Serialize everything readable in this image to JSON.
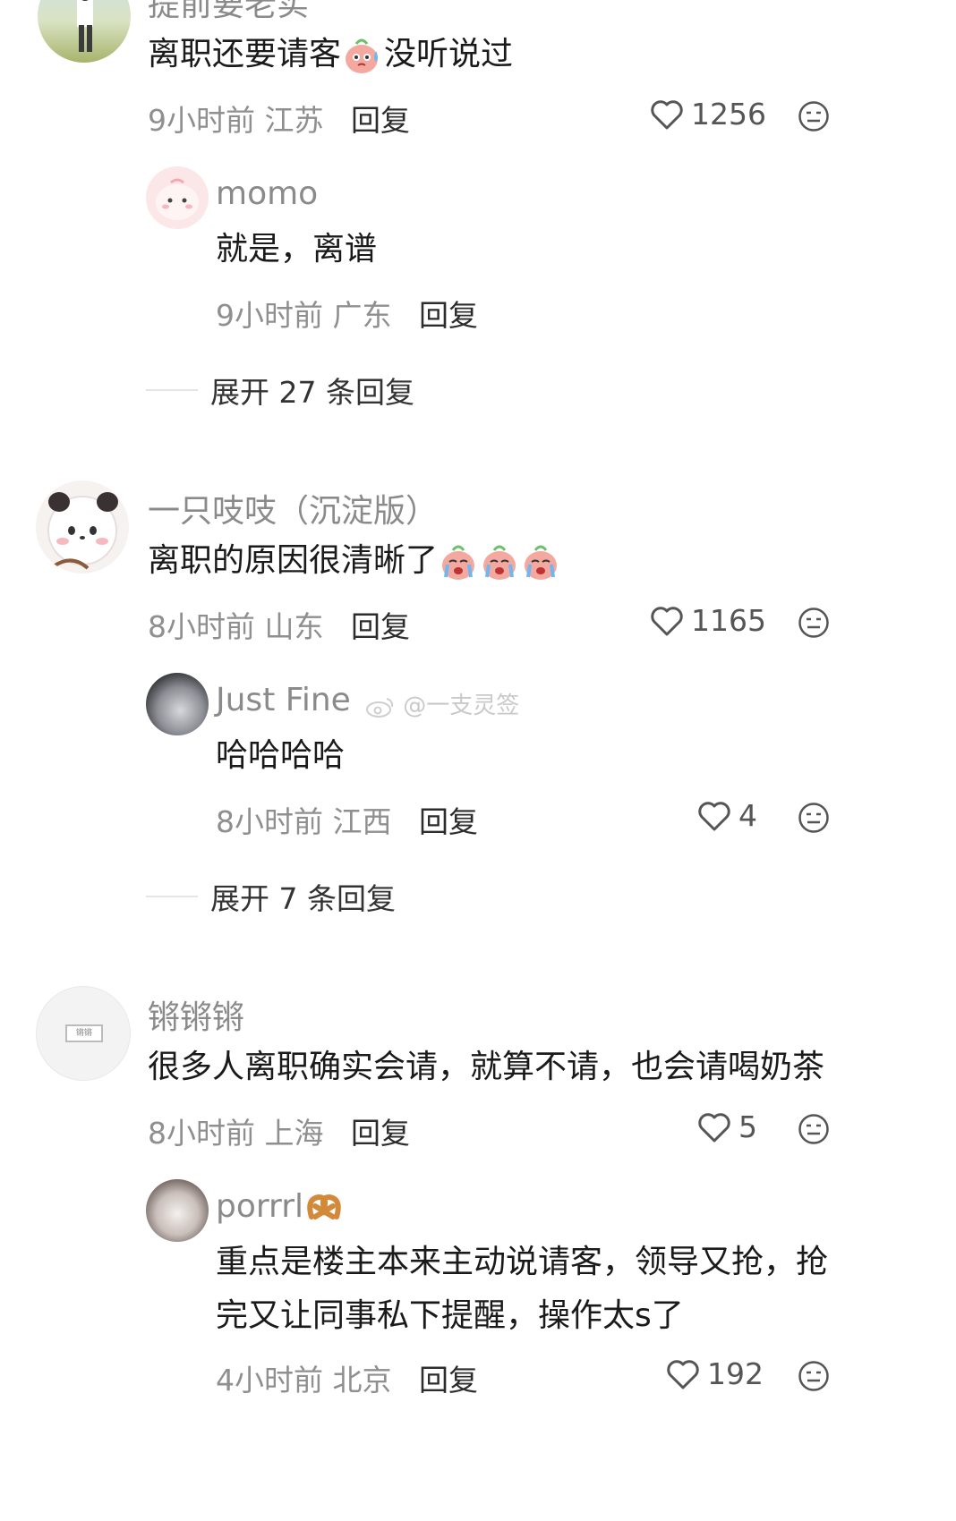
{
  "comments": [
    {
      "user": "提前要老实",
      "text_before": "离职还要请客",
      "text_after": "没听说过",
      "time": "9小时前",
      "location": "江苏",
      "reply_label": "回复",
      "likes": "1256",
      "replies": [
        {
          "user": "momo",
          "text": "就是，离谱",
          "time": "9小时前",
          "location": "广东",
          "reply_label": "回复"
        }
      ],
      "expand_label": "展开 27 条回复"
    },
    {
      "user": "一只吱吱（沉淀版）",
      "text": "离职的原因很清晰了",
      "time": "8小时前",
      "location": "山东",
      "reply_label": "回复",
      "likes": "1165",
      "replies": [
        {
          "user": "Just Fine",
          "text": "哈哈哈哈",
          "time": "8小时前",
          "location": "江西",
          "reply_label": "回复",
          "likes": "4"
        }
      ],
      "expand_label": "展开 7 条回复"
    },
    {
      "user": "锵锵锵",
      "text": "很多人离职确实会请，就算不请，也会请喝奶茶",
      "time": "8小时前",
      "location": "上海",
      "reply_label": "回复",
      "likes": "5",
      "avatar_text": "锵锵",
      "replies": [
        {
          "user": "porrrl",
          "text_line1": "重点是楼主本来主动说请客，领导又抢，抢",
          "text_line2": "完又让同事私下提醒，操作太s了",
          "time": "4小时前",
          "location": "北京",
          "reply_label": "回复",
          "likes": "192"
        }
      ]
    }
  ],
  "watermark": "@一支灵签",
  "colors": {
    "name": "#8a8a8a",
    "meta": "#8f8f8f",
    "text": "#1a1a1a",
    "reply": "#2c2c2c"
  }
}
